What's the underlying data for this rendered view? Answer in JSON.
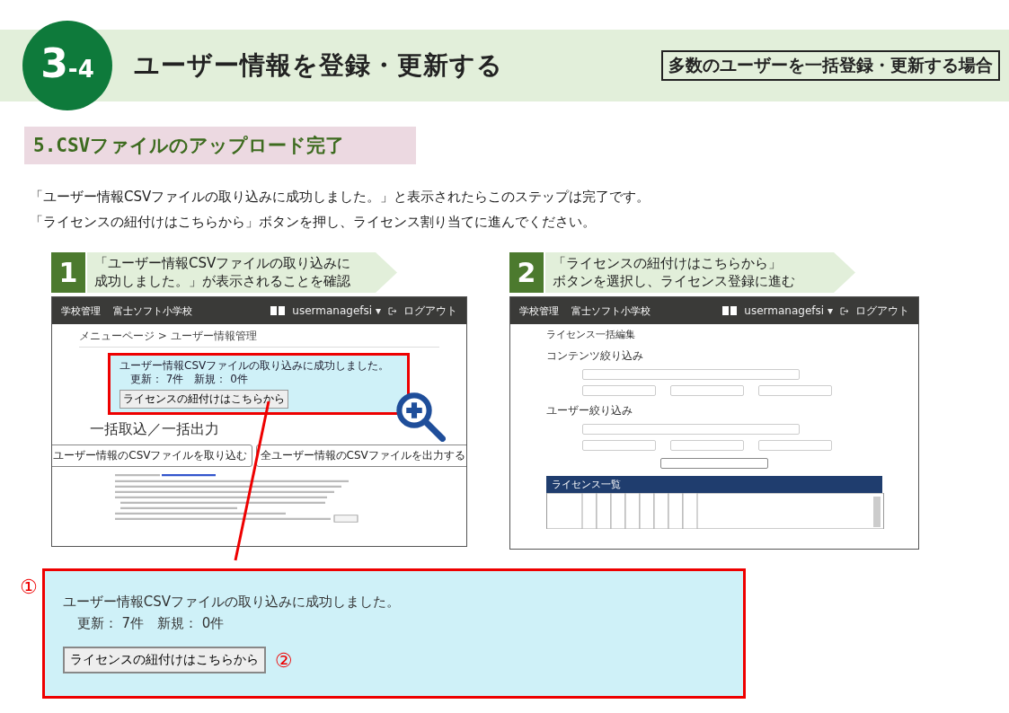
{
  "header": {
    "badge_major": "3",
    "badge_minor": "-4",
    "title": "ユーザー情報を登録・更新する",
    "case_label": "多数のユーザーを一括登録・更新する場合"
  },
  "section_title": "5.CSVファイルのアップロード完了",
  "intro": [
    "「ユーザー情報CSVファイルの取り込みに成功しました。」と表示されたらこのステップは完了です。",
    "「ライセンスの紐付けはこちらから」ボタンを押し、ライセンス割り当てに進んでください。"
  ],
  "steps": [
    {
      "number": "1",
      "lines": [
        "「ユーザー情報CSVファイルの取り込みに",
        "成功しました。」が表示されることを確認"
      ]
    },
    {
      "number": "2",
      "lines": [
        "「ライセンスの紐付けはこちらから」",
        "ボタンを選択し、ライセンス登録に進む"
      ]
    }
  ],
  "screen_1": {
    "nav": {
      "items": [
        "学校管理",
        "富士ソフト小学校"
      ],
      "user": "usermanagefsi",
      "user_caret": "▾",
      "logout": "ログアウト"
    },
    "breadcrumb": "メニューページ > ユーザー情報管理",
    "success": {
      "message": "ユーザー情報CSVファイルの取り込みに成功しました。",
      "counts": "更新： 7件　新規： 0件",
      "button": "ライセンスの紐付けはこちらから"
    },
    "heading": "一括取込／一括出力",
    "buttons": [
      "ユーザー情報のCSVファイルを取り込む",
      "全ユーザー情報のCSVファイルを出力する"
    ]
  },
  "screen_2": {
    "nav": {
      "items": [
        "学校管理",
        "富士ソフト小学校"
      ],
      "user": "usermanagefsi",
      "user_caret": "▾",
      "logout": "ログアウト"
    },
    "page_title": "ライセンス一括編集",
    "sections": [
      "コンテンツ絞り込み",
      "ユーザー絞り込み"
    ],
    "table_title": "ライセンス一覧"
  },
  "zoom": {
    "marker": "①",
    "message": "ユーザー情報CSVファイルの取り込みに成功しました。",
    "counts": "更新： 7件　新規： 0件",
    "button": "ライセンスの紐付けはこちらから",
    "button_marker": "②"
  }
}
